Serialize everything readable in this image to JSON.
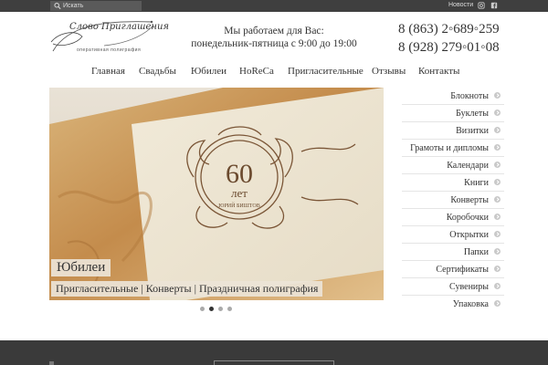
{
  "topbar": {
    "search_placeholder": "Искать",
    "news_label": "Новости",
    "social_icons": [
      "instagram-icon",
      "facebook-icon"
    ]
  },
  "logo": {
    "script_text": "Слово Приглашения",
    "subtitle": "оперативная полиграфия"
  },
  "header": {
    "work_line1": "Мы работаем для Вас:",
    "work_line2": "понедельник-пятница с 9:00 до 19:00",
    "phone1": "8 (863) 2◦689◦259",
    "phone2": "8 (928) 279◦01◦08"
  },
  "nav": {
    "items": [
      "Главная",
      "Свадьбы",
      "Юбилеи",
      "HoReCa",
      "Пригласительные",
      "Отзывы",
      "Контакты"
    ]
  },
  "slider": {
    "caption_title": "Юбилеи",
    "caption_sub": "Пригласительные | Конверты | Праздничная полиграфия",
    "card_number": "60",
    "card_word": "лет",
    "card_name": "ЮРИЙ БИШТОВ",
    "dots_count": 4,
    "active_dot": 1
  },
  "sidebar": {
    "items": [
      "Блокноты",
      "Буклеты",
      "Визитки",
      "Грамоты и дипломы",
      "Календари",
      "Книги",
      "Конверты",
      "Коробочки",
      "Открытки",
      "Папки",
      "Сертификаты",
      "Сувениры",
      "Упаковка"
    ]
  },
  "colors": {
    "topbar": "#3f3f3f",
    "footer": "#3a3a3a",
    "card_print": "#6b4a2e",
    "gold_foil": "#c89a58"
  }
}
